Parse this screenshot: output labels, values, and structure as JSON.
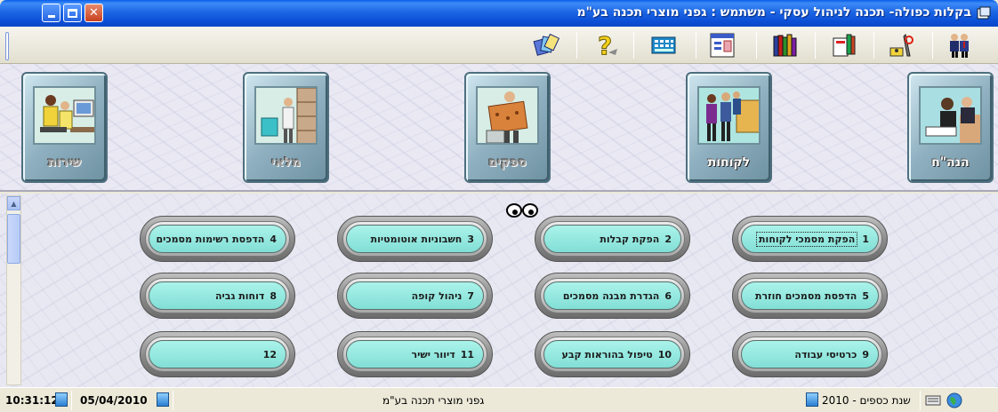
{
  "window": {
    "title": "בקלות כפולה- תכנה לניהול עסקי - משתמש : גפני מוצרי תכנה בע\"מ"
  },
  "toolbar": {
    "icons": [
      "users-icon",
      "tools-icon",
      "books-icon",
      "library-icon",
      "chart-window-icon",
      "calculator-icon",
      "help-icon",
      "cards-icon"
    ]
  },
  "modules": [
    {
      "label": "הנה\"ח",
      "icon": "office-scene-icon",
      "active": true
    },
    {
      "label": "לקוחות",
      "icon": "customers-scene-icon",
      "active": true
    },
    {
      "label": "ספקים",
      "icon": "supplier-scene-icon",
      "active": false
    },
    {
      "label": "מלאי",
      "icon": "warehouse-scene-icon",
      "active": false
    },
    {
      "label": "שירות",
      "icon": "service-scene-icon",
      "active": false
    }
  ],
  "menu": {
    "items": [
      {
        "num": "1",
        "label": "הפקת מסמכי לקוחות",
        "selected": true
      },
      {
        "num": "2",
        "label": "הפקת קבלות"
      },
      {
        "num": "3",
        "label": "חשבוניות אוטומטיות"
      },
      {
        "num": "4",
        "label": "הדפסת רשימות מסמכים"
      },
      {
        "num": "5",
        "label": "הדפסת מסמכים חוזרת"
      },
      {
        "num": "6",
        "label": "הגדרת מבנה מסמכים"
      },
      {
        "num": "7",
        "label": "ניהול קופה"
      },
      {
        "num": "8",
        "label": "דוחות גביה"
      },
      {
        "num": "9",
        "label": "כרטיסי עבודה"
      },
      {
        "num": "10",
        "label": "טיפול בהוראות קבע"
      },
      {
        "num": "11",
        "label": "דיוור ישיר"
      },
      {
        "num": "12",
        "label": ""
      }
    ]
  },
  "status": {
    "fiscal_year": "שנת כספים - 2010",
    "company": "גפני מוצרי תכנה בע\"מ",
    "date": "05/04/2010",
    "time": "10:31:12"
  }
}
